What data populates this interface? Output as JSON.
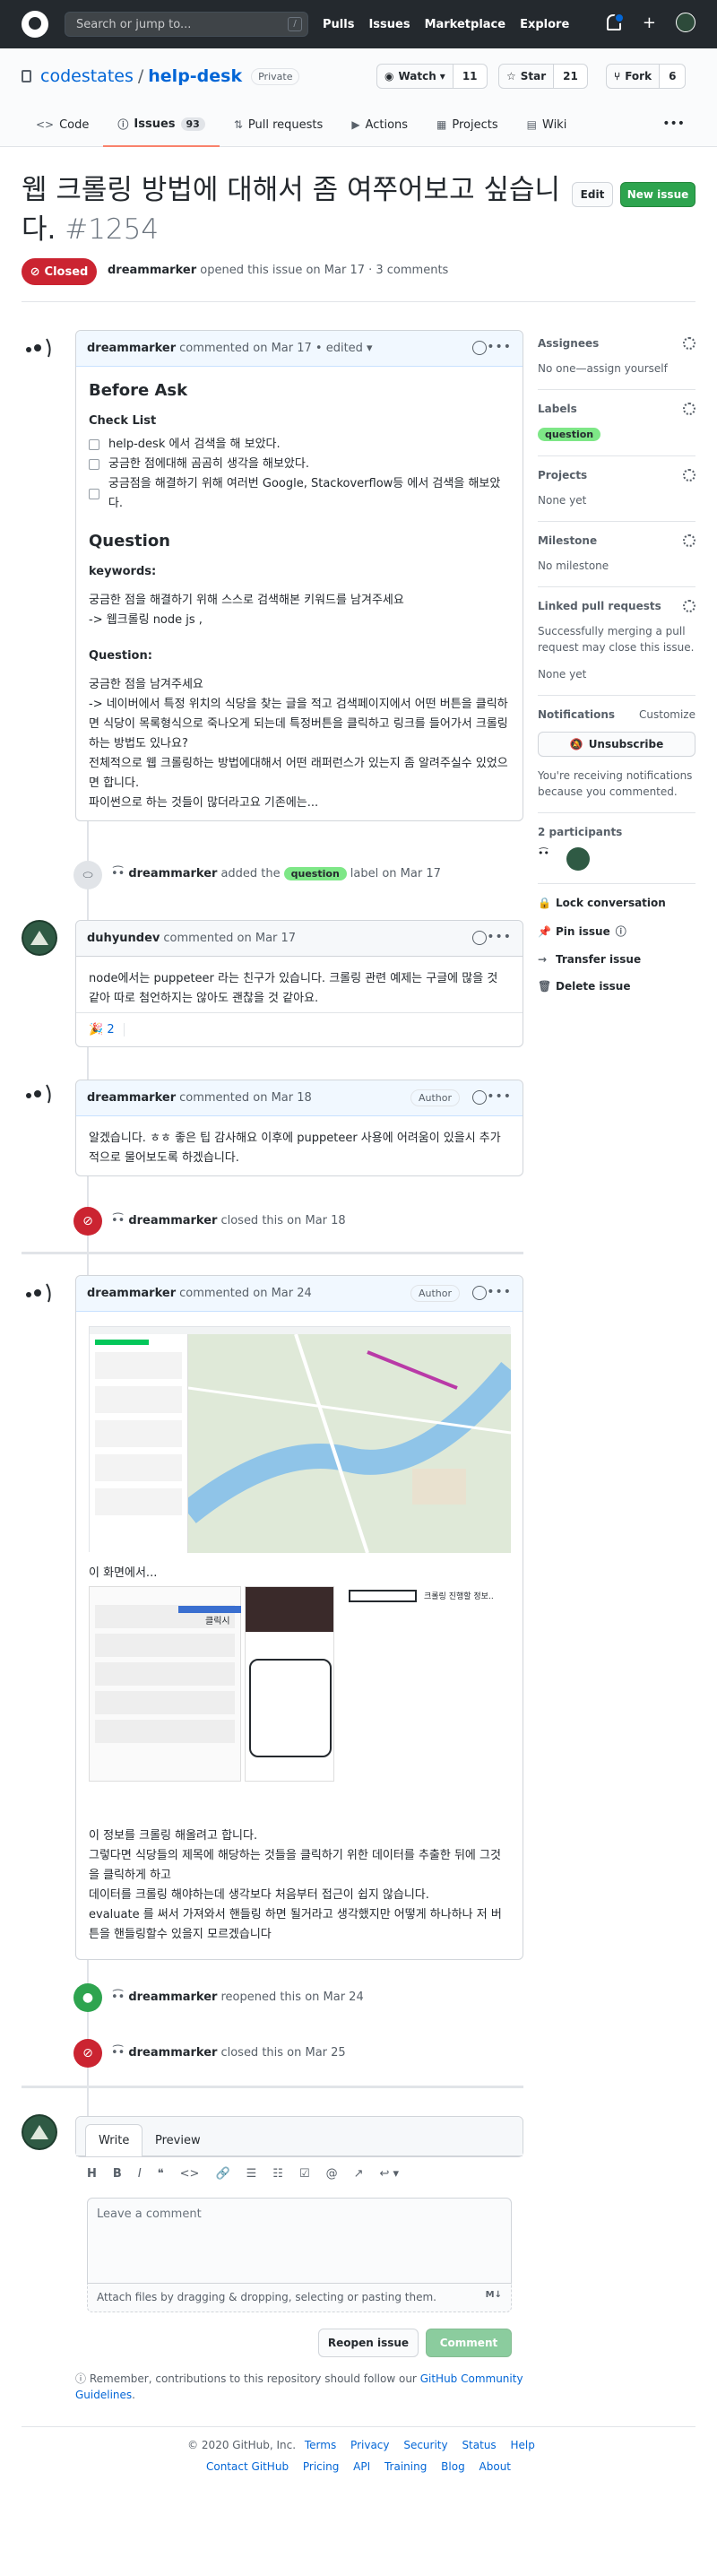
{
  "header": {
    "search_placeholder": "Search or jump to...",
    "search_key": "/",
    "nav": [
      "Pulls",
      "Issues",
      "Marketplace",
      "Explore"
    ],
    "plus": "+"
  },
  "repo": {
    "owner": "codestates",
    "sep": "/",
    "name": "help-desk",
    "visibility": "Private",
    "watch_label": "Watch",
    "watch_count": "11",
    "star_label": "Star",
    "star_count": "21",
    "fork_label": "Fork",
    "fork_count": "6",
    "tabs": [
      {
        "label": "Code",
        "icon": "<>"
      },
      {
        "label": "Issues",
        "icon": "ⓘ",
        "count": "93"
      },
      {
        "label": "Pull requests",
        "icon": "⇅"
      },
      {
        "label": "Actions",
        "icon": "▶"
      },
      {
        "label": "Projects",
        "icon": "▦"
      },
      {
        "label": "Wiki",
        "icon": "▤"
      }
    ],
    "more": "•••"
  },
  "issue": {
    "title": "웹 크롤링 방법에 대해서 좀 여쭈어보고 싶습니다.",
    "number": "#1254",
    "edit_label": "Edit",
    "new_issue_label": "New issue",
    "state": "Closed",
    "author": "dreammarker",
    "meta_text": "opened this issue on Mar 17 · 3 comments"
  },
  "comments": {
    "c1": {
      "author": "dreammarker",
      "meta": "commented on Mar 17 • edited ▾",
      "h_before": "Before Ask",
      "h_checklist": "Check List",
      "checks": [
        "help-desk 에서 검색을 해 보았다.",
        "궁금한 점에대해 곰곰히 생각을 해보았다.",
        "궁금점을 해결하기 위해 여러번 Google, Stackoverflow등 에서 검색을 해보았다."
      ],
      "h_question": "Question",
      "kw_title": "keywords:",
      "kw_line1": "궁금한 점을 해결하기 위해 스스로 검색해본 키워드를 남겨주세요",
      "kw_line2": "-> 웹크롤링 node js ,",
      "q_title": "Question:",
      "q_line1": "궁금한 점을 남겨주세요",
      "q_line2": "-> 네이버에서 특정 위치의 식당을 찾는 글을 적고 검색페이지에서 어떤 버튼을 클릭하면 식당이 목록형식으로 죽나오게 되는데 특정버튼을 클릭하고 링크를 들어가서 크롤링하는 방법도 있나요?",
      "q_line3": "전체적으로 웹 크롤링하는 방법에대해서 어떤 래퍼런스가 있는지 좀 알려주실수 있었으면 합니다.",
      "q_line4": "파이썬으로 하는 것들이 많더라고요 기존에는..."
    },
    "label_event": {
      "actor": "dreammarker",
      "pre": "added the",
      "label": "question",
      "post": "label on Mar 17"
    },
    "c2": {
      "author": "duhyundev",
      "meta": "commented on Mar 17",
      "text": "node에서는 puppeteer 라는 친구가 있습니다. 크롤링 관련 예제는 구글에 많을 것 같아 따로 첨언하지는 않아도 괜찮을 것 같아요.",
      "reaction_emoji": "🎉",
      "reaction_count": "2"
    },
    "c3": {
      "author": "dreammarker",
      "meta": "commented on Mar 18",
      "author_badge": "Author",
      "text": "알겠습니다. ㅎㅎ 좋은 팁 감사해요 이후에 puppeteer 사용에 어려움이 있을시 추가적으로 물어보도록 하겠습니다."
    },
    "closed1": {
      "actor": "dreammarker",
      "text": "closed this on Mar 18"
    },
    "c4": {
      "author": "dreammarker",
      "meta": "commented on Mar 24",
      "author_badge": "Author",
      "caption1": "이 화면에서...",
      "shot2_click": "클릭시",
      "shot2_right": "크롤링 진행할 정보..",
      "p1": "이 정보를 크롤링 해올려고 합니다.",
      "p2": "그렇다면 식당들의 제목에 해당하는 것들을 클릭하기 위한 데이터를 추출한 뒤에 그것을 클릭하게 하고",
      "p3": "데이터를 크롤링 해야하는데 생각보다 처음부터 접근이 쉽지 않습니다.",
      "p4": "evaluate 를 써서 가져와서 핸들링 하면 될거라고 생각했지만 어떻게 하나하나 저 버튼을 핸들링할수 있을지 모르겠습니다"
    },
    "reopened": {
      "actor": "dreammarker",
      "text": "reopened this on Mar 24"
    },
    "closed2": {
      "actor": "dreammarker",
      "text": "closed this on Mar 25"
    }
  },
  "editor": {
    "write": "Write",
    "preview": "Preview",
    "tools": [
      "H",
      "B",
      "I",
      "❝",
      "<>",
      "🔗",
      "☰",
      "☷",
      "☑",
      "@",
      "↗",
      "↩ ▾"
    ],
    "placeholder": "Leave a comment",
    "attach": "Attach files by dragging & dropping, selecting or pasting them.",
    "md": "M↓",
    "reopen": "Reopen issue",
    "comment": "Comment",
    "note_pre": "Remember, contributions to this repository should follow our",
    "note_link": "GitHub Community Guidelines",
    "note_post": "."
  },
  "sidebar": {
    "assignees_h": "Assignees",
    "assignees_v": "No one—assign yourself",
    "labels_h": "Labels",
    "labels_v": "question",
    "projects_h": "Projects",
    "projects_v": "None yet",
    "milestone_h": "Milestone",
    "milestone_v": "No milestone",
    "linked_h": "Linked pull requests",
    "linked_desc": "Successfully merging a pull request may close this issue.",
    "linked_v": "None yet",
    "notif_h": "Notifications",
    "customize": "Customize",
    "unsubscribe": "Unsubscribe",
    "notif_desc": "You're receiving notifications because you commented.",
    "participants_h": "2 participants",
    "lock": "Lock conversation",
    "pin": "Pin issue",
    "transfer": "Transfer issue",
    "delete": "Delete issue"
  },
  "footer": {
    "copyright": "© 2020 GitHub, Inc.",
    "links1": [
      "Terms",
      "Privacy",
      "Security",
      "Status",
      "Help"
    ],
    "links2": [
      "Contact GitHub",
      "Pricing",
      "API",
      "Training",
      "Blog",
      "About"
    ]
  },
  "colors": {
    "closed": "#cb2431",
    "open": "#2ea44f",
    "label": "#7ee787",
    "link": "#0366d6"
  }
}
